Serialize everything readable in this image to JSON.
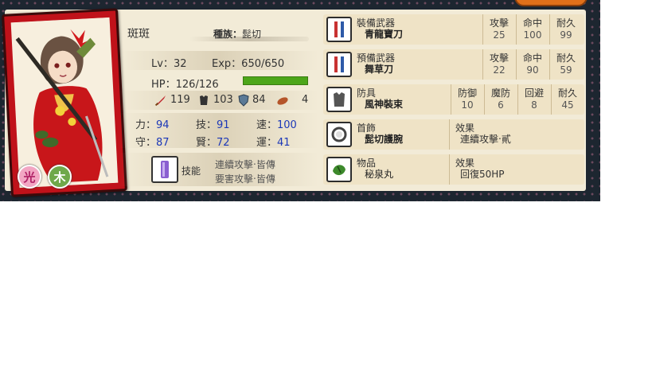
{
  "character": {
    "name": "斑斑",
    "race_label": "種族：",
    "race": "髭切",
    "level_label": "Lv：",
    "level": "32",
    "exp_label": "Exp：",
    "exp": "650/650",
    "hp_label": "HP：",
    "hp": "126/126",
    "hp_fraction": 1.0,
    "attack": "119",
    "defense": "103",
    "magic_def": "84",
    "item_count": "4",
    "badge_pink": "光",
    "badge_green": "木"
  },
  "attributes": [
    {
      "label": "力：",
      "value": "94"
    },
    {
      "label": "技：",
      "value": "91"
    },
    {
      "label": "速：",
      "value": "100"
    },
    {
      "label": "守：",
      "value": "87"
    },
    {
      "label": "賢：",
      "value": "72"
    },
    {
      "label": "運：",
      "value": "41"
    }
  ],
  "skills": {
    "label": "技能",
    "lines": [
      "連續攻擊‧皆傳",
      "要害攻擊‧皆傳"
    ]
  },
  "equipment": [
    {
      "type": "裝備武器",
      "name": "青龍寶刀",
      "cols": [
        {
          "h": "攻擊",
          "v": "25"
        },
        {
          "h": "命中",
          "v": "100"
        },
        {
          "h": "耐久",
          "v": "99"
        }
      ]
    },
    {
      "type": "預備武器",
      "name": "舞草刀",
      "cols": [
        {
          "h": "攻擊",
          "v": "22"
        },
        {
          "h": "命中",
          "v": "90"
        },
        {
          "h": "耐久",
          "v": "59"
        }
      ]
    },
    {
      "type": "防具",
      "name": "風神裝束",
      "cols": [
        {
          "h": "防御",
          "v": "10"
        },
        {
          "h": "魔防",
          "v": "6"
        },
        {
          "h": "回避",
          "v": "8"
        },
        {
          "h": "耐久",
          "v": "45"
        }
      ]
    },
    {
      "type": "首飾",
      "name": "髭切護腕",
      "effect_label": "效果",
      "effect": "連續攻擊‧貳"
    },
    {
      "type": "物品",
      "name": "秘泉丸",
      "effect_label": "效果",
      "effect": "回復50HP"
    }
  ],
  "colors": {
    "hp_bar": "#4da61a",
    "stat_value": "#1c38b8",
    "card_red": "#c0121a"
  }
}
